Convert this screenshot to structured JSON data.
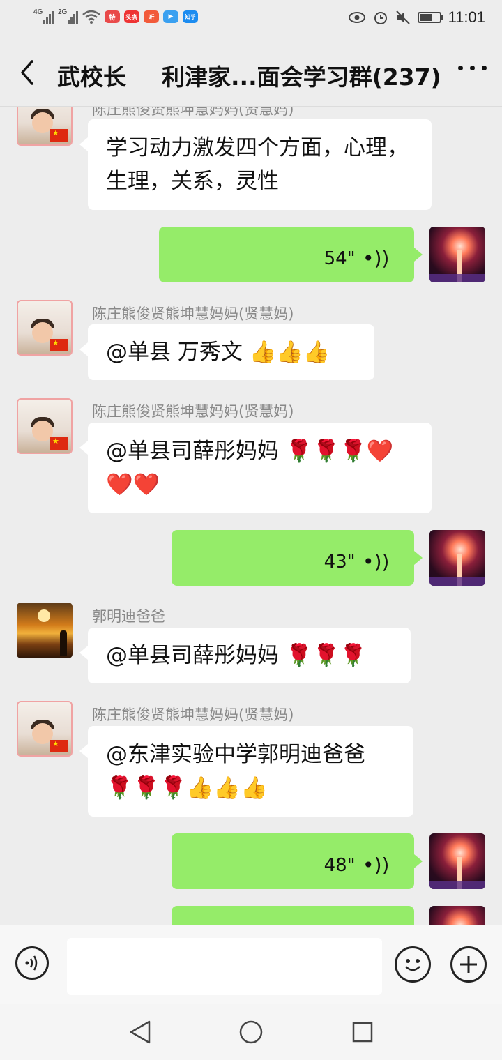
{
  "status_bar": {
    "left_icons": [
      "4G",
      "2G",
      "wifi-icon",
      "app-icon-1",
      "头条",
      "听",
      "app-icon-4",
      "知乎"
    ],
    "right_icons": [
      "eye-icon",
      "alarm-icon",
      "mute-icon",
      "battery-icon"
    ],
    "time": "11:01"
  },
  "nav": {
    "contact": "武校长",
    "title": "利津家...面会学习群(237)"
  },
  "messages": [
    {
      "type": "text",
      "sender": "陈庄熊俊贤熊坤慧妈妈(贤慧妈)",
      "lines": [
        "学习动力激发四个方面，心理，",
        "生理，关系，灵性"
      ]
    },
    {
      "type": "voice",
      "self": true,
      "duration": "54\""
    },
    {
      "type": "text",
      "sender": "陈庄熊俊贤熊坤慧妈妈(贤慧妈)",
      "lines": [
        "@单县  万秀文 👍👍👍"
      ]
    },
    {
      "type": "text",
      "sender": "陈庄熊俊贤熊坤慧妈妈(贤慧妈)",
      "lines": [
        "@单县司薛彤妈妈 🌹🌹🌹❤️",
        "❤️❤️"
      ]
    },
    {
      "type": "voice",
      "self": true,
      "duration": "43\""
    },
    {
      "type": "text",
      "sender": "郭明迪爸爸",
      "lines": [
        "@单县司薛彤妈妈 🌹🌹🌹"
      ]
    },
    {
      "type": "text",
      "sender": "陈庄熊俊贤熊坤慧妈妈(贤慧妈)",
      "lines": [
        "@东津实验中学郭明迪爸爸",
        "🌹🌹🌹👍👍👍"
      ]
    },
    {
      "type": "voice",
      "self": true,
      "duration": "48\""
    }
  ],
  "input_bar": {
    "text": "",
    "placeholder": ""
  },
  "colors": {
    "background": "#ededed",
    "out_bubble": "#95ec69",
    "in_bubble": "#ffffff"
  }
}
